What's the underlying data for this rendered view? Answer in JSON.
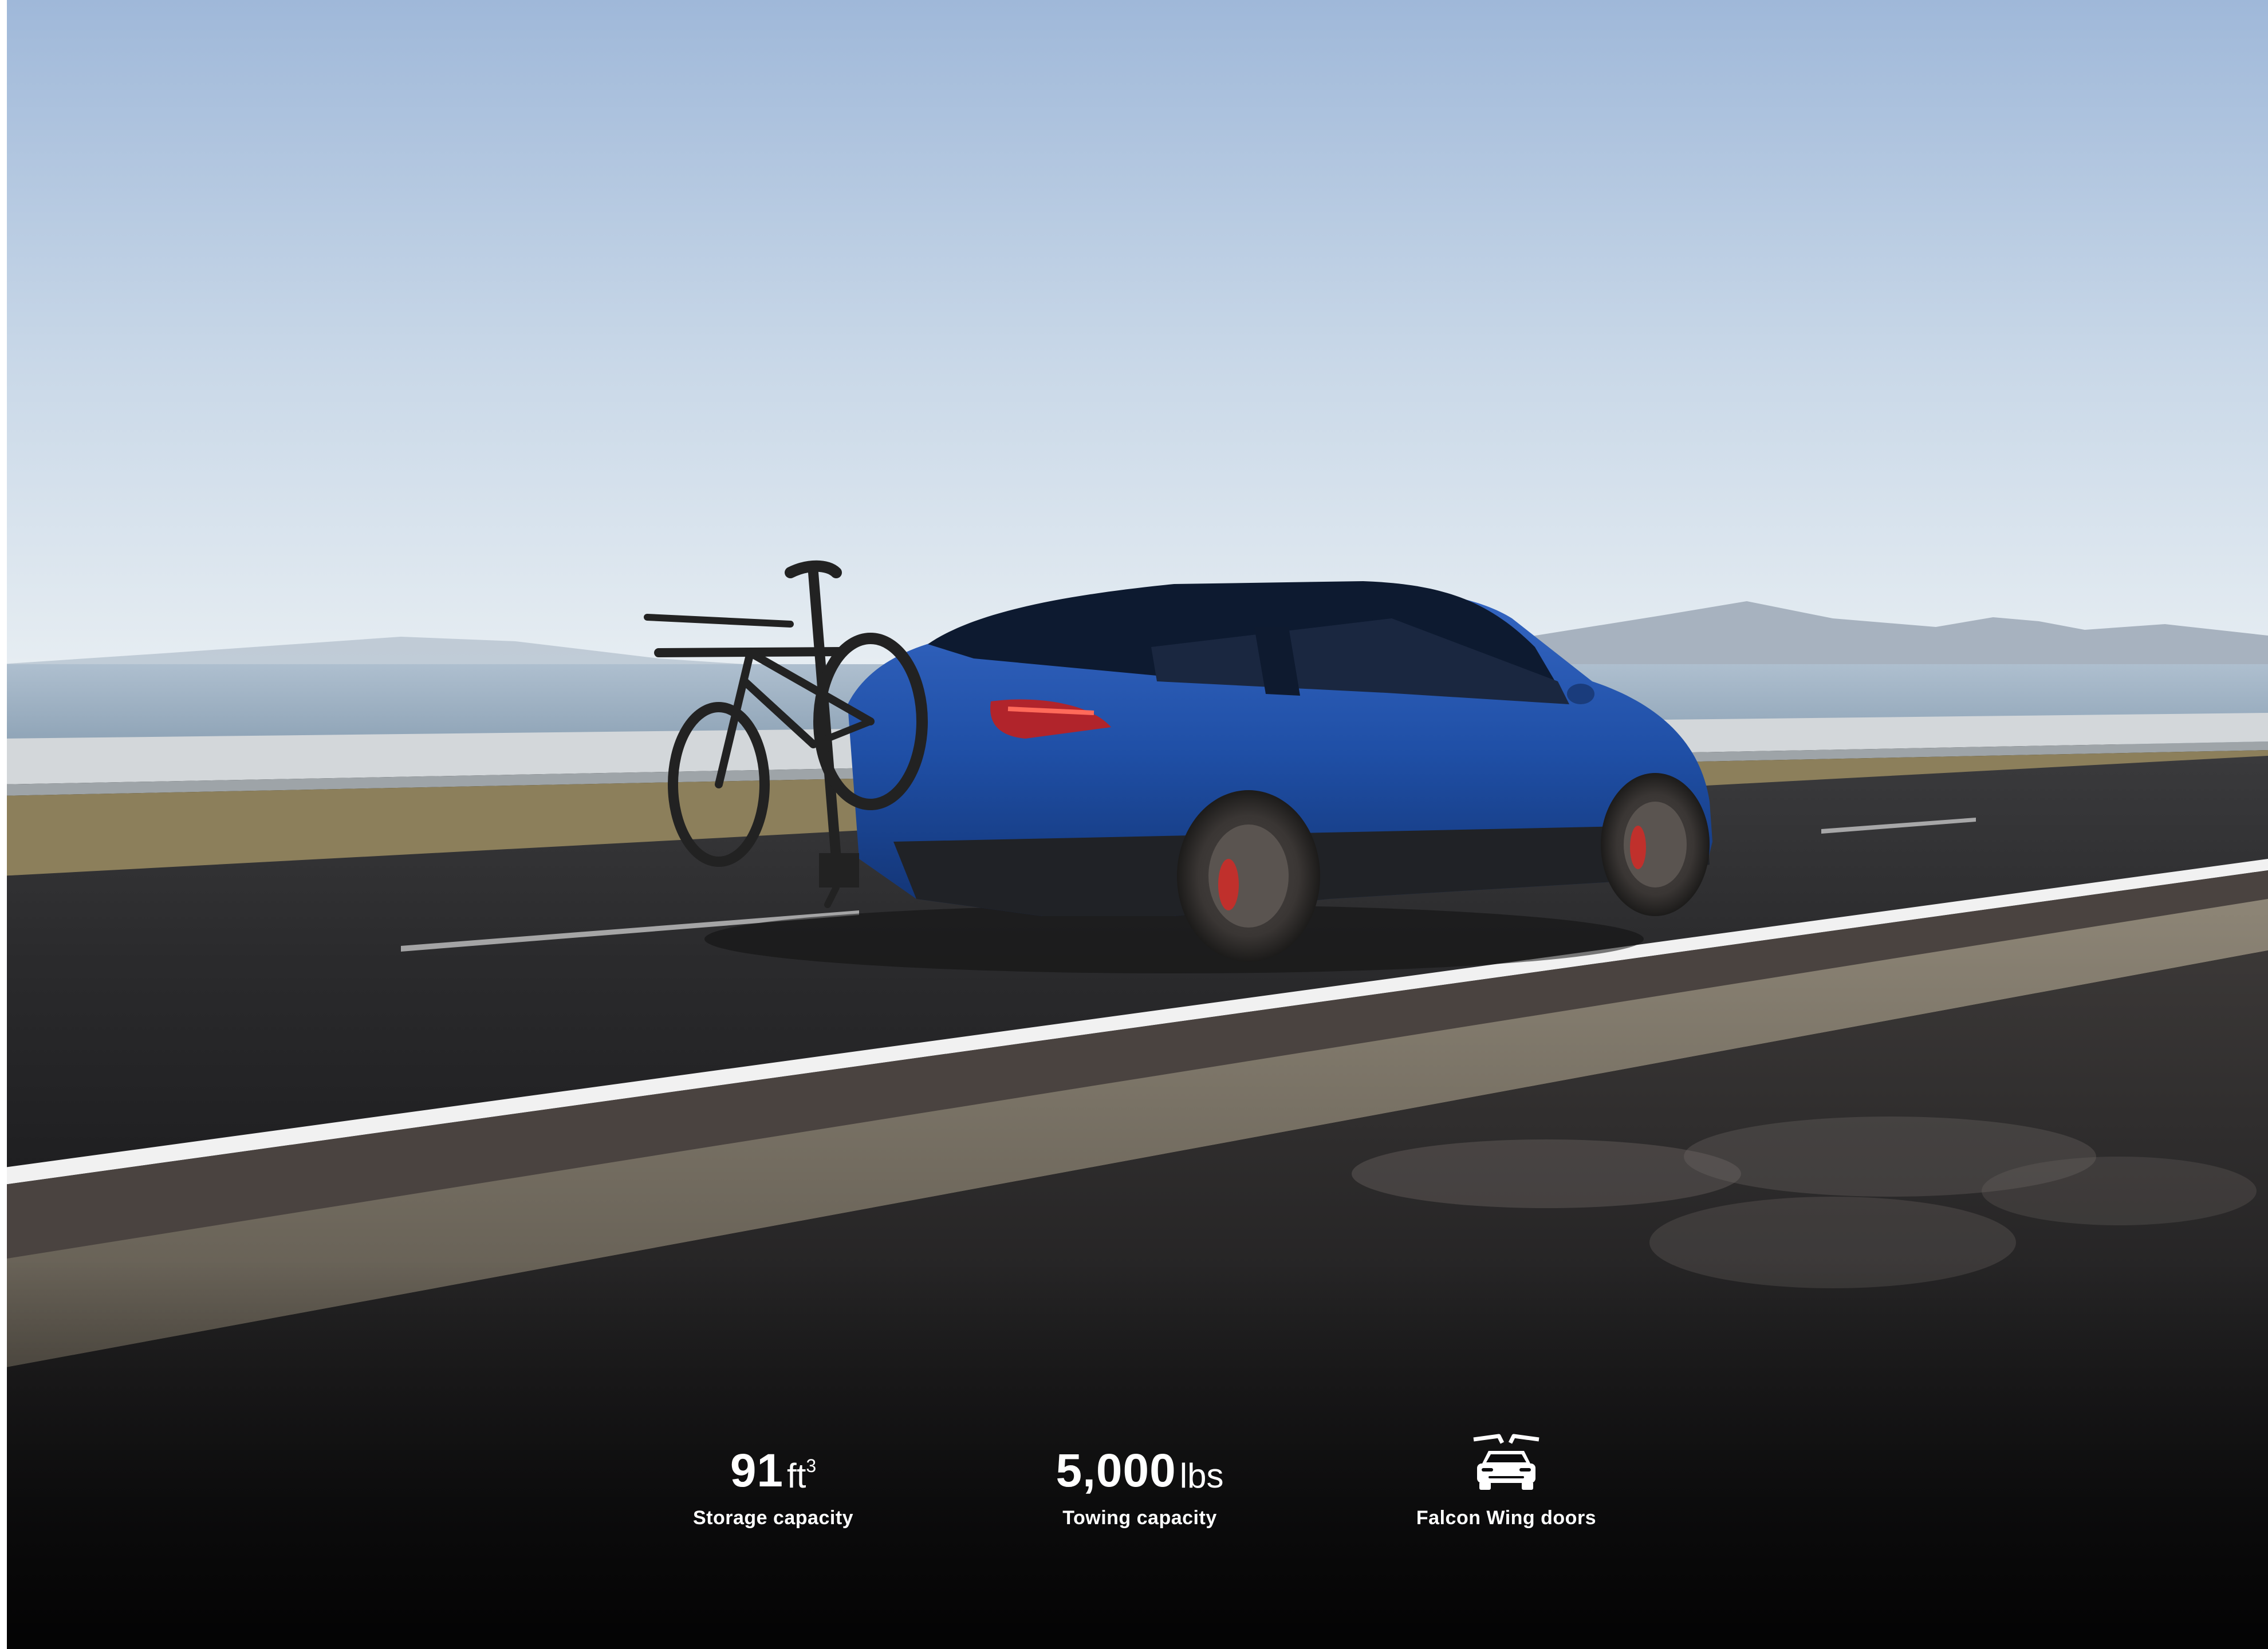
{
  "specs": [
    {
      "number": "91",
      "unit": "ft",
      "unit_superscript": "3",
      "label": "Storage capacity"
    },
    {
      "number": "5,000",
      "unit": "lbs",
      "label": "Towing capacity"
    },
    {
      "icon": "falcon-wing-doors-icon",
      "label": "Falcon Wing doors"
    }
  ],
  "colors": {
    "vehicle_paint": "#1f4fa6",
    "spec_text": "#ffffff",
    "sky_top": "#a9c0dc",
    "road": "#2a2a2b"
  }
}
